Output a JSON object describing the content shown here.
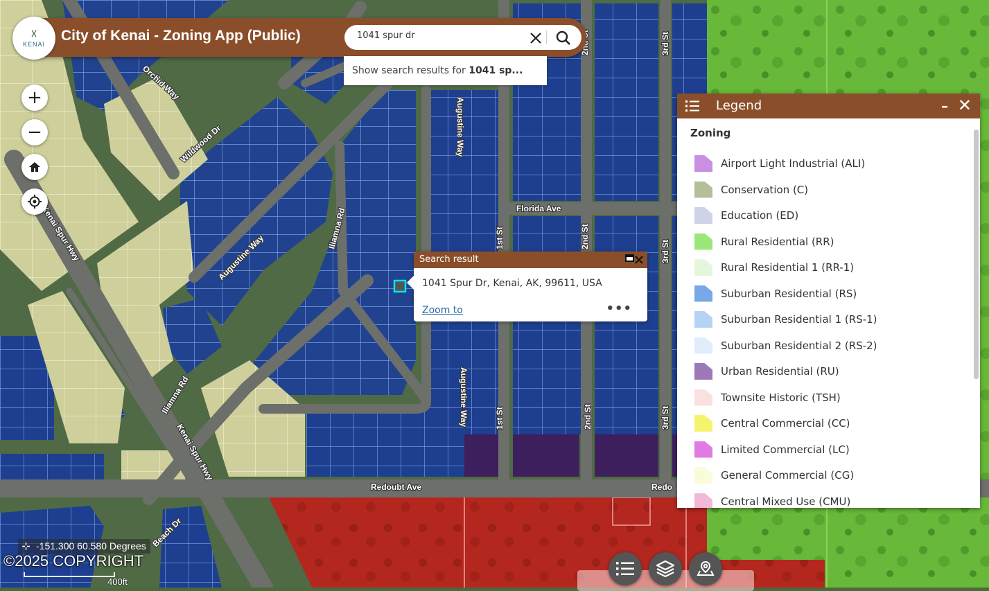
{
  "app": {
    "title": "City of Kenai - Zoning App (Public)",
    "logo_text": "KENAI",
    "logo_mark": "☓"
  },
  "search": {
    "value": "1041 spur dr",
    "clear_icon": "close-icon",
    "search_icon": "search-icon",
    "suggestion_prefix": "Show search results for ",
    "suggestion_term": "1041 sp..."
  },
  "map_controls": {
    "zoom_in": "+",
    "zoom_out": "−",
    "home_icon": "home-icon",
    "locate_icon": "locate-icon"
  },
  "popup": {
    "title": "Search result",
    "address": "1041 Spur Dr, Kenai, AK, 99611, USA",
    "zoom_link": "Zoom to",
    "more": "•••"
  },
  "legend": {
    "title": "Legend",
    "minimize": "–",
    "close": "✕",
    "group": "Zoning",
    "items": [
      {
        "label": "Airport Light Industrial (ALI)",
        "color": "#c98fe0"
      },
      {
        "label": "Conservation (C)",
        "color": "#b3bf9a"
      },
      {
        "label": "Education (ED)",
        "color": "#cfd3ea"
      },
      {
        "label": "Rural Residential (RR)",
        "color": "#9be87a"
      },
      {
        "label": "Rural Residential 1 (RR-1)",
        "color": "#e4f7dd"
      },
      {
        "label": "Suburban Residential (RS)",
        "color": "#78a8e6"
      },
      {
        "label": "Suburban Residential 1 (RS-1)",
        "color": "#b5d3f5"
      },
      {
        "label": "Suburban Residential 2 (RS-2)",
        "color": "#e0eefb"
      },
      {
        "label": "Urban Residential (RU)",
        "color": "#9d78b8"
      },
      {
        "label": "Townsite Historic (TSH)",
        "color": "#fbe0e0"
      },
      {
        "label": "Central Commercial (CC)",
        "color": "#f5f46e"
      },
      {
        "label": "Limited Commercial (LC)",
        "color": "#e27ae6"
      },
      {
        "label": "General Commercial (CG)",
        "color": "#fafbd9"
      },
      {
        "label": "Central Mixed Use (CMU)",
        "color": "#f2b8d8"
      }
    ]
  },
  "status": {
    "coordinates": "-151.300 60.580 Degrees",
    "copyright": "©2025 COPYRIGHT",
    "scale": "400ft"
  },
  "streets": {
    "florida": "Florida Ave",
    "redoubt": "Redoubt Ave",
    "redoubt_cut": "Redo",
    "augustine": "Augustine Way",
    "iliamna": "Iliamna Rd",
    "kenai_spur": "Kenai Spur Hwy",
    "wildwood": "Wildwood Dr",
    "orchid": "Orchid Way",
    "first": "1st St",
    "second": "2nd St",
    "third": "3rd St",
    "beach": "Beach Dr"
  },
  "toolbar": {
    "list_icon": "list-icon",
    "layers_icon": "layers-icon",
    "location_icon": "map-pin-icon"
  },
  "colors": {
    "header_brown": "#8a4f2a",
    "zoning_blue": "#1e3f8f",
    "zoning_red": "#b3271f",
    "zoning_purple": "#3d1f5e",
    "cream": "#d8d8a8",
    "green": "#6fbf3c"
  }
}
